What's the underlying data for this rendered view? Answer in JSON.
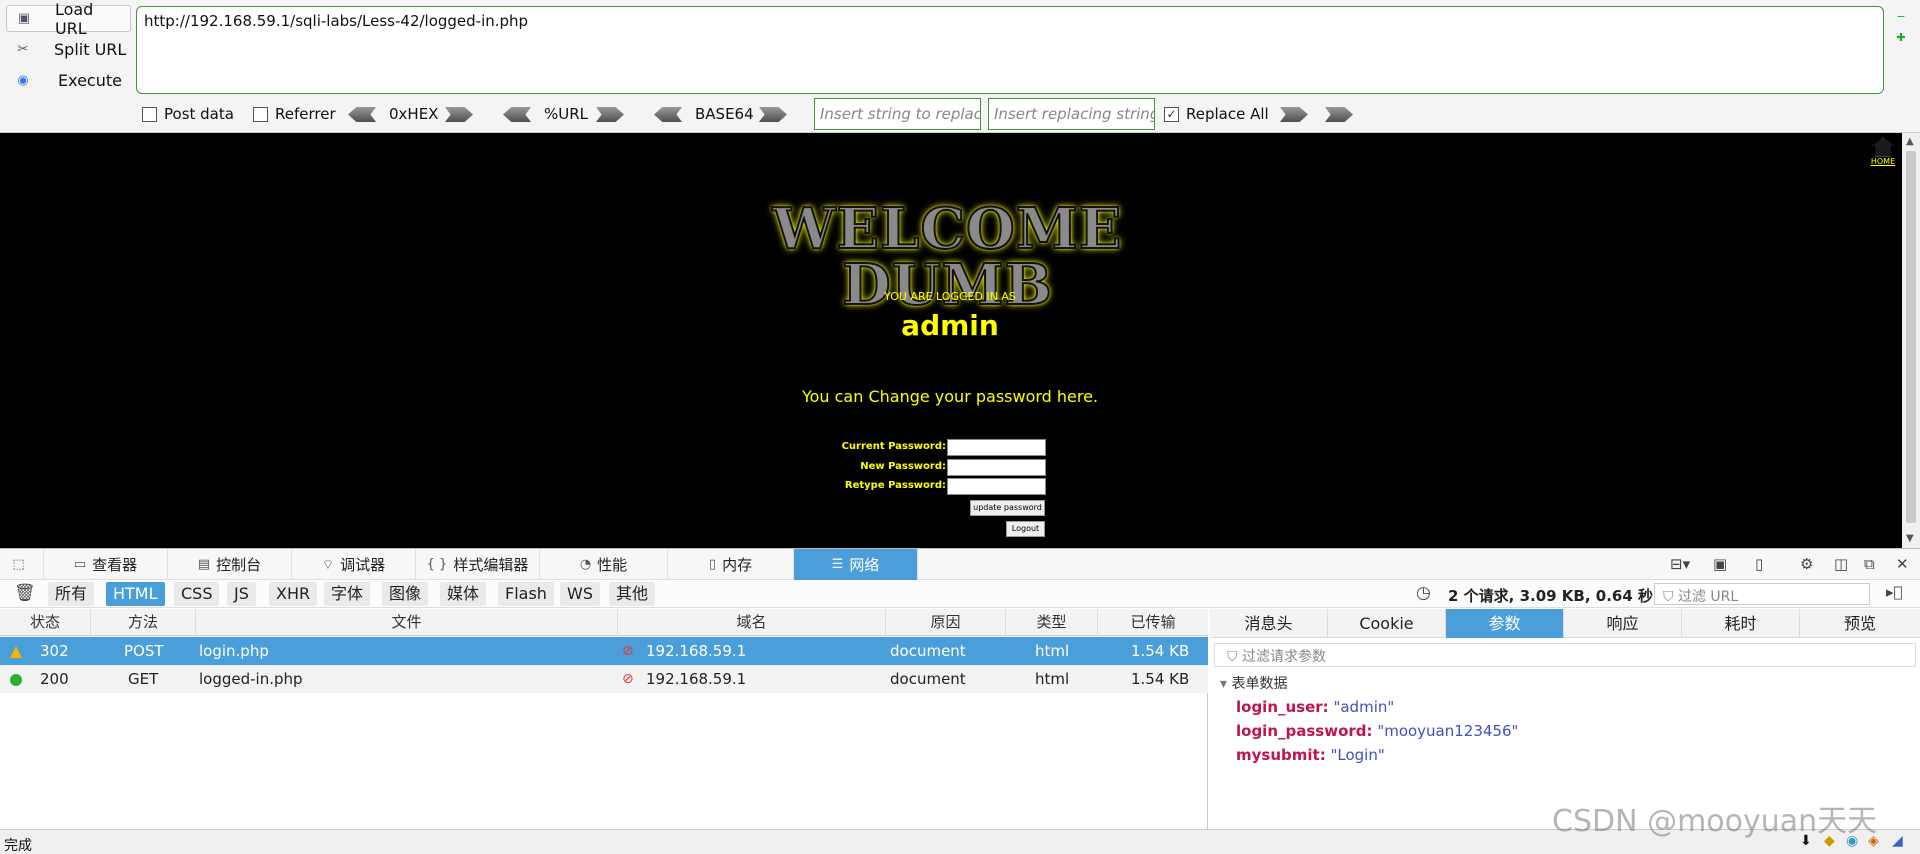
{
  "hackbar": {
    "load_url": "Load URL",
    "split_url": "Split URL",
    "execute": "Execute",
    "url": "http://192.168.59.1/sqli-labs/Less-42/logged-in.php",
    "post_data": "Post data",
    "referrer": "Referrer",
    "hex": "0xHEX",
    "url_enc": "%URL",
    "base64": "BASE64",
    "insert_replace_placeholder": "Insert string to replace",
    "insert_replacing_placeholder": "Insert replacing string",
    "replace_all": "Replace All"
  },
  "page": {
    "home": "HOME",
    "welcome": "WELCOME DUMB",
    "logged_as": "YOU ARE LOGGED IN AS",
    "user": "admin",
    "change_msg": "You can Change your password here.",
    "current_password": "Current Password:",
    "new_password": "New Password:",
    "retype_password": "Retype Password:",
    "update_btn": "update password",
    "logout_btn": "Logout"
  },
  "devtools": {
    "tabs": [
      "查看器",
      "控制台",
      "调试器",
      "样式编辑器",
      "性能",
      "内存",
      "网络"
    ],
    "filters": [
      "所有",
      "HTML",
      "CSS",
      "JS",
      "XHR",
      "字体",
      "图像",
      "媒体",
      "Flash",
      "WS",
      "其他"
    ],
    "summary": "2 个请求, 3.09 KB, 0.64 秒",
    "url_filter_placeholder": "过滤 URL",
    "columns": [
      "状态",
      "方法",
      "文件",
      "域名",
      "原因",
      "类型",
      "已传输"
    ],
    "rows": [
      {
        "status": "302",
        "method": "POST",
        "file": "login.php",
        "host": "192.168.59.1",
        "cause": "document",
        "type": "html",
        "size": "1.54 KB"
      },
      {
        "status": "200",
        "method": "GET",
        "file": "logged-in.php",
        "host": "192.168.59.1",
        "cause": "document",
        "type": "html",
        "size": "1.54 KB"
      }
    ],
    "side_tabs": [
      "消息头",
      "Cookie",
      "参数",
      "响应",
      "耗时",
      "预览"
    ],
    "param_filter_placeholder": "过滤请求参数",
    "form_data_label": "表单数据",
    "params": [
      {
        "key": "login_user:",
        "value": "\"admin\""
      },
      {
        "key": "login_password:",
        "value": "\"mooyuan123456\""
      },
      {
        "key": "mysubmit:",
        "value": "\"Login\""
      }
    ]
  },
  "status_text": "完成",
  "watermark": "CSDN @mooyuan天天",
  "colors": {
    "accent": "#4a9eda",
    "page_bg": "#000000",
    "page_text": "#ffff00",
    "url_border": "#3a9a3a"
  }
}
